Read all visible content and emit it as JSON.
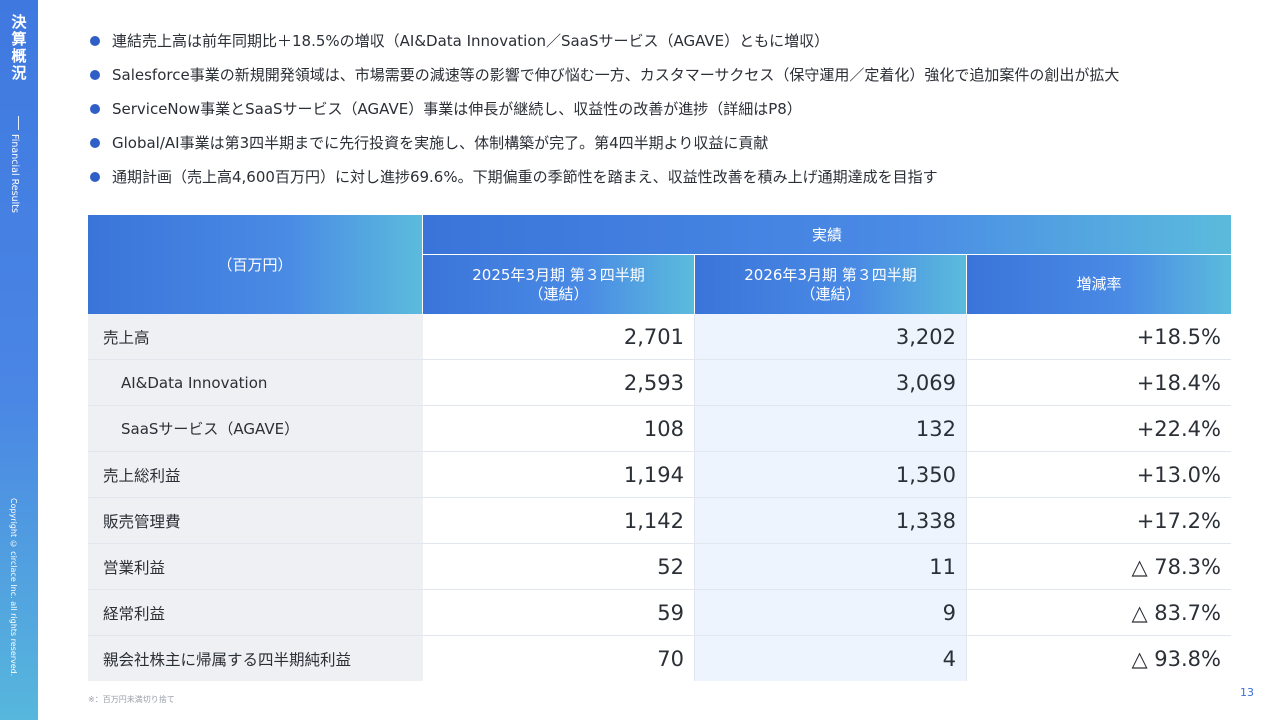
{
  "sidebar": {
    "title": "決算概況",
    "subtitle": "Financial Results",
    "copyright": "Copyright © circlace Inc. all rights reserved."
  },
  "bullets": [
    "連結売上高は前年同期比＋18.5%の増収（AI&Data Innovation／SaaSサービス（AGAVE）ともに増収）",
    "Salesforce事業の新規開発領域は、市場需要の減速等の影響で伸び悩む一方、カスタマーサクセス（保守運用／定着化）強化で追加案件の創出が拡大",
    "ServiceNow事業とSaaSサービス（AGAVE）事業は伸長が継続し、収益性の改善が進捗（詳細はP8）",
    "Global/AI事業は第3四半期までに先行投資を実施し、体制構築が完了。第4四半期より収益に貢献",
    "通期計画（売上高4,600百万円）に対し進捗69.6%。下期偏重の季節性を踏まえ、収益性改善を積み上げ通期達成を目指す"
  ],
  "table": {
    "unit_label": "（百万円）",
    "group_label": "実績",
    "col_prev_line1": "2025年3月期 第３四半期",
    "col_prev_line2": "（連結）",
    "col_curr_line1": "2026年3月期 第３四半期",
    "col_curr_line2": "（連結）",
    "col_rate": "増減率",
    "rows": [
      {
        "label": "売上高",
        "prev": "2,701",
        "curr": "3,202",
        "rate": "+18.5%"
      },
      {
        "label": "AI&Data Innovation",
        "prev": "2,593",
        "curr": "3,069",
        "rate": "+18.4%"
      },
      {
        "label": "SaaSサービス（AGAVE）",
        "prev": "108",
        "curr": "132",
        "rate": "+22.4%"
      },
      {
        "label": "売上総利益",
        "prev": "1,194",
        "curr": "1,350",
        "rate": "+13.0%"
      },
      {
        "label": "販売管理費",
        "prev": "1,142",
        "curr": "1,338",
        "rate": "+17.2%"
      },
      {
        "label": "営業利益",
        "prev": "52",
        "curr": "11",
        "rate": "△ 78.3%"
      },
      {
        "label": "経常利益",
        "prev": "59",
        "curr": "9",
        "rate": "△ 83.7%"
      },
      {
        "label": "親会社株主に帰属する四半期純利益",
        "prev": "70",
        "curr": "4",
        "rate": "△ 93.8%"
      }
    ]
  },
  "footnote": "※：百万円未満切り捨て",
  "page_number": "13",
  "colors": {
    "accent": "#3a74d9",
    "accent_light": "#5bbbdc",
    "bullet": "#2f5ec7",
    "label_bg": "#eef0f3",
    "current_col_bg": "#edf4fd"
  }
}
